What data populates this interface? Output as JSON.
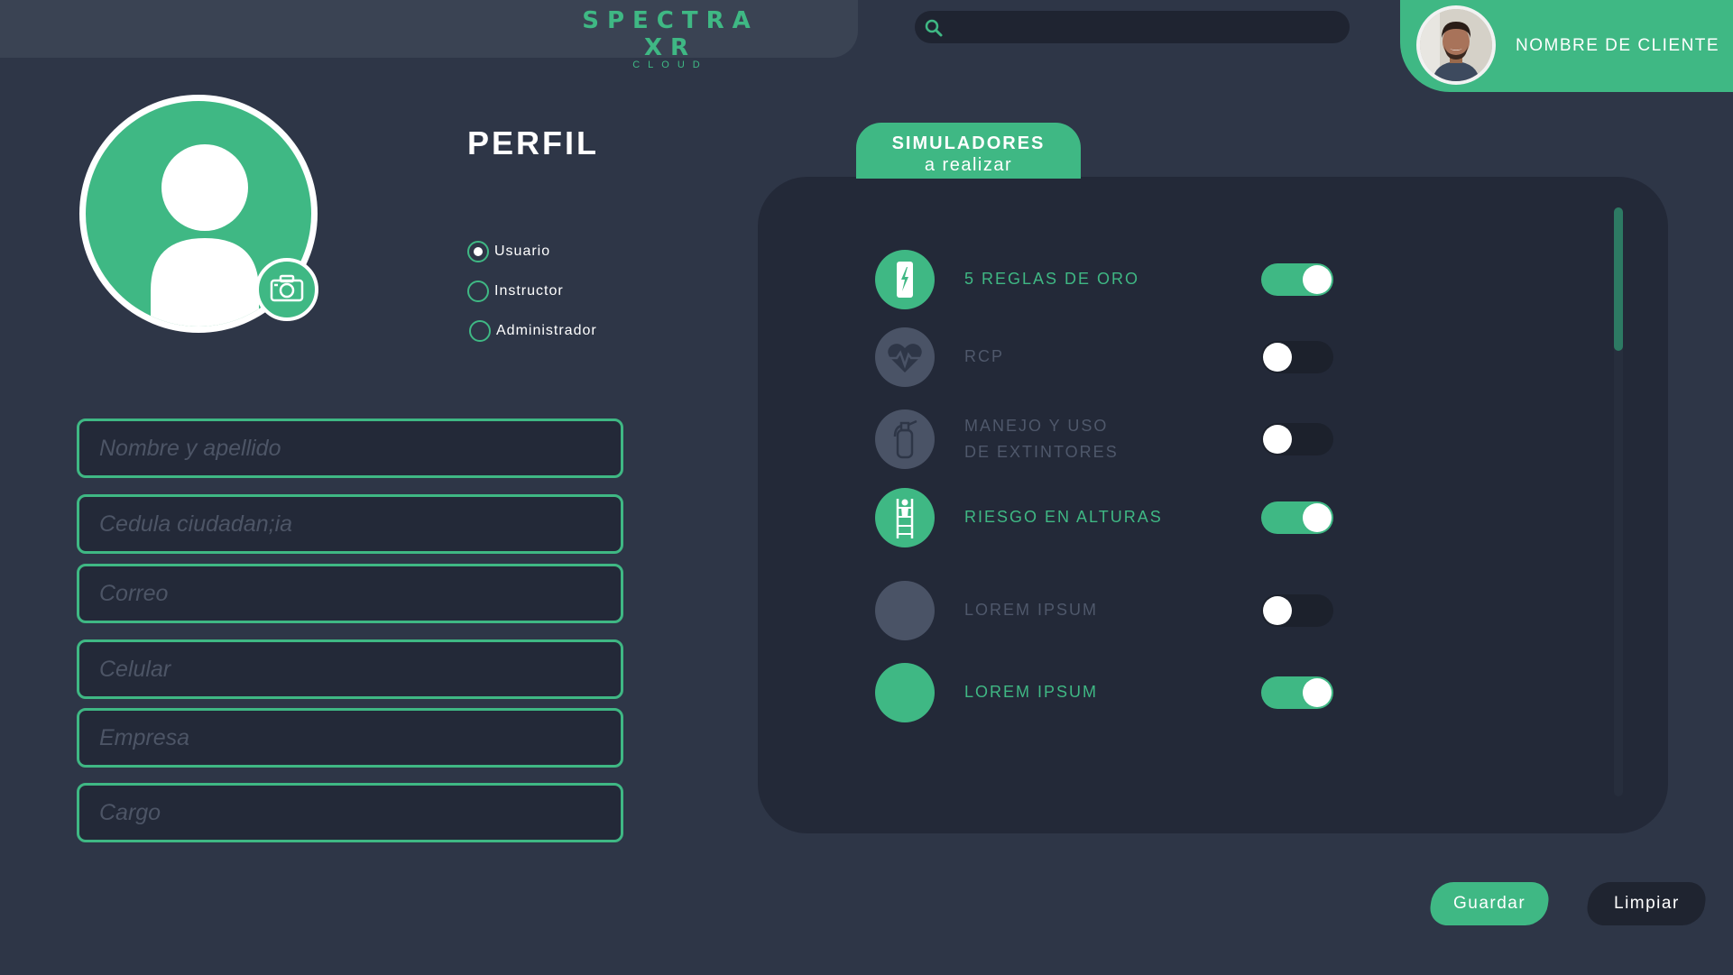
{
  "colors": {
    "background": "#2e3647",
    "accent": "#3fb884",
    "panel": "#232938",
    "disabled": "#4f586b"
  },
  "header": {
    "logo_text": "SPECTRA XR",
    "logo_subtitle": "CLOUD",
    "search": {
      "icon": "search-icon",
      "placeholder": "",
      "value": ""
    },
    "client_name": "NOMBRE DE CLIENTE"
  },
  "profile": {
    "title": "PERFIL",
    "roles": [
      {
        "label": "Usuario",
        "selected": true
      },
      {
        "label": "Instructor",
        "selected": false
      },
      {
        "label": "Administrador",
        "selected": false
      }
    ],
    "fields": [
      {
        "placeholder": "Nombre y apellido",
        "value": ""
      },
      {
        "placeholder": "Cedula ciudadan;ia",
        "value": ""
      },
      {
        "placeholder": "Correo",
        "value": ""
      },
      {
        "placeholder": "Celular",
        "value": ""
      },
      {
        "placeholder": "Empresa",
        "value": ""
      },
      {
        "placeholder": "Cargo",
        "value": ""
      }
    ]
  },
  "simulators": {
    "tab_title": "SIMULADORES",
    "tab_subtitle": "a realizar",
    "items": [
      {
        "line1": "5 REGLAS DE ORO",
        "line2": "",
        "icon": "electric-panel-icon",
        "enabled": true
      },
      {
        "line1": "RCP",
        "line2": "",
        "icon": "heartbeat-icon",
        "enabled": false
      },
      {
        "line1": "MANEJO Y USO",
        "line2": "DE EXTINTORES",
        "icon": "fire-extinguisher-icon",
        "enabled": false
      },
      {
        "line1": "RIESGO EN ALTURAS",
        "line2": "",
        "icon": "ladder-climber-icon",
        "enabled": true
      },
      {
        "line1": "LOREM IPSUM",
        "line2": "",
        "icon": "placeholder-circle-icon",
        "enabled": false
      },
      {
        "line1": "LOREM IPSUM",
        "line2": "",
        "icon": "placeholder-circle-icon",
        "enabled": true
      }
    ]
  },
  "actions": {
    "save_label": "Guardar",
    "clear_label": "Limpiar"
  }
}
